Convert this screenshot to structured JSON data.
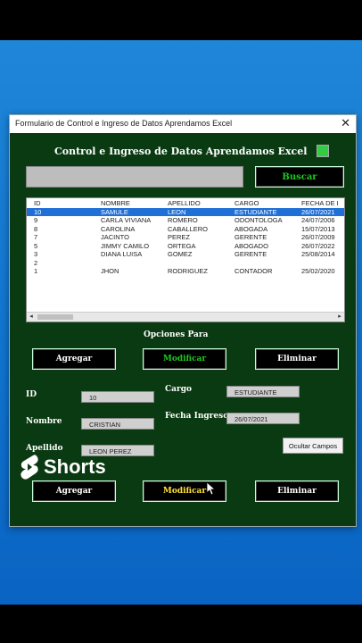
{
  "window": {
    "title": "Formulario de Control e Ingreso de Datos Aprendamos Excel",
    "close": "✕"
  },
  "header": {
    "title": "Control e Ingreso de Datos Aprendamos Excel"
  },
  "search": {
    "value": "",
    "button": "Buscar"
  },
  "list": {
    "columns": [
      "ID",
      "NOMBRE",
      "APELLIDO",
      "CARGO",
      "FECHA DE I"
    ],
    "rows": [
      {
        "id": "10",
        "nombre": "SAMULE",
        "apellido": "LEON",
        "cargo": "ESTUDIANTE",
        "fecha": "26/07/2021",
        "selected": true
      },
      {
        "id": "9",
        "nombre": "CARLA VIVIANA",
        "apellido": "ROMERO",
        "cargo": "ODONTOLOGA",
        "fecha": "24/07/2006"
      },
      {
        "id": "8",
        "nombre": "CAROLINA",
        "apellido": "CABALLERO",
        "cargo": "ABOGADA",
        "fecha": "15/07/2013"
      },
      {
        "id": "7",
        "nombre": "JACINTO",
        "apellido": "PEREZ",
        "cargo": "GERENTE",
        "fecha": "26/07/2009"
      },
      {
        "id": "5",
        "nombre": "JIMMY CAMILO",
        "apellido": "ORTEGA",
        "cargo": "ABOGADO",
        "fecha": "26/07/2022"
      },
      {
        "id": "3",
        "nombre": "DIANA LUISA",
        "apellido": "GOMEZ",
        "cargo": "GERENTE",
        "fecha": "25/08/2014"
      },
      {
        "id": "2",
        "nombre": "",
        "apellido": "",
        "cargo": "",
        "fecha": ""
      },
      {
        "id": "1",
        "nombre": "JHON",
        "apellido": "RODRIGUEZ",
        "cargo": "CONTADOR",
        "fecha": "25/02/2020"
      }
    ]
  },
  "options": {
    "title": "Opciones Para",
    "agregar": "Agregar",
    "modificar": "Modificar",
    "eliminar": "Eliminar"
  },
  "fields": {
    "id_label": "ID",
    "id_value": "10",
    "nombre_label": "Nombre",
    "nombre_value": "CRISTIAN",
    "apellido_label": "Apellido",
    "apellido_value": "LEON PEREZ",
    "cargo_label": "Cargo",
    "cargo_value": "ESTUDIANTE",
    "fecha_label": "Fecha Ingreso",
    "fecha_value": "26/07/2021",
    "ocultar": "Ocultar Campos"
  },
  "bottom": {
    "agregar": "Agregar",
    "modificar": "Modificar",
    "eliminar": "Eliminar"
  },
  "overlay": {
    "shorts": "Shorts"
  },
  "colors": {
    "form_bg": "#0a3a12",
    "green_text": "#1ec71e",
    "yellow_text": "#ffe033",
    "selection": "#1f6fd6"
  }
}
